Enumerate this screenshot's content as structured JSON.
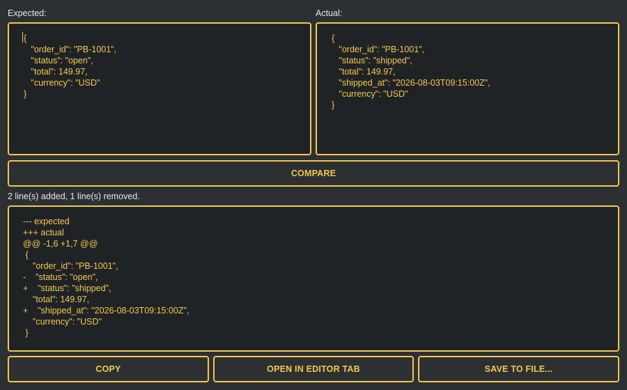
{
  "expected": {
    "label": "Expected:",
    "content": "{\n   \"order_id\": \"PB-1001\",\n   \"status\": \"open\",\n   \"total\": 149.97,\n   \"currency\": \"USD\"\n}"
  },
  "actual": {
    "label": "Actual:",
    "content": "{\n   \"order_id\": \"PB-1001\",\n   \"status\": \"shipped\",\n   \"total\": 149.97,\n   \"shipped_at\": \"2026-08-03T09:15:00Z\",\n   \"currency\": \"USD\"\n}"
  },
  "compare_label": "COMPARE",
  "summary": "2 line(s) added, 1 line(s) removed.",
  "diff": {
    "content": "--- expected\n+++ actual\n@@ -1,6 +1,7 @@\n {\n    \"order_id\": \"PB-1001\",\n-    \"status\": \"open\",\n+    \"status\": \"shipped\",\n    \"total\": 149.97,\n+    \"shipped_at\": \"2026-08-03T09:15:00Z\",\n    \"currency\": \"USD\"\n }"
  },
  "actions": {
    "copy": "COPY",
    "open_in_editor": "OPEN IN EDITOR TAB",
    "save_to_file": "SAVE TO FILE..."
  },
  "colors": {
    "accent": "#f2c94c",
    "background": "#2d3033",
    "panel": "#202326"
  }
}
